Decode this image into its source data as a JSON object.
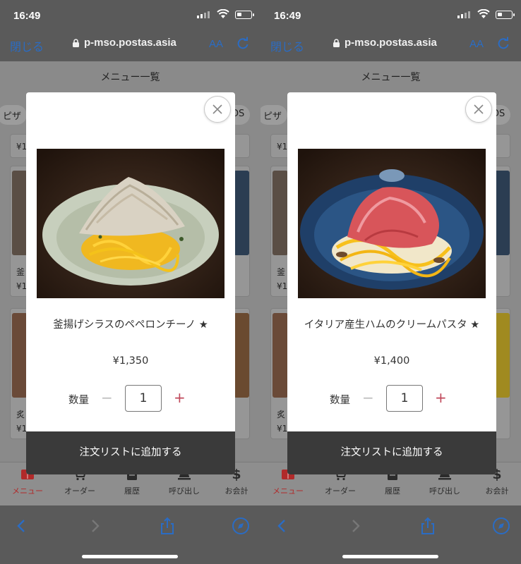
{
  "screens": [
    {
      "status": {
        "time": "16:49"
      },
      "browser": {
        "close_label": "閉じる",
        "url": "p-mso.postas.asia",
        "text_size": "AA"
      },
      "page": {
        "title": "メニュー一覧",
        "chip_left": "ピザ",
        "chip_right": "DS",
        "snippets": [
          "¥1",
          "釜",
          "¥1",
          "炙",
          "¥1"
        ]
      },
      "modal": {
        "item_name": "釜揚げシラスのペペロンチーノ ★",
        "price": "¥1,350",
        "qty_label": "数量",
        "minus": "−",
        "qty_value": "1",
        "plus": "+",
        "add_label": "注文リストに追加する",
        "photo_desc_icon": "pasta-shirasu-photo"
      },
      "tabs": [
        {
          "label": "メニュー",
          "icon": "menu-book-icon",
          "active": true
        },
        {
          "label": "オーダー",
          "icon": "cart-icon",
          "active": false
        },
        {
          "label": "履歴",
          "icon": "history-icon",
          "active": false
        },
        {
          "label": "呼び出し",
          "icon": "bell-icon",
          "active": false
        },
        {
          "label": "お会計",
          "icon": "dollar-icon",
          "active": false
        }
      ]
    },
    {
      "status": {
        "time": "16:49"
      },
      "browser": {
        "close_label": "閉じる",
        "url": "p-mso.postas.asia",
        "text_size": "AA"
      },
      "page": {
        "title": "メニュー一覧",
        "chip_left": "ピザ",
        "chip_right": "DS",
        "snippets": [
          "¥1",
          "釜",
          "¥1",
          "炙",
          "¥1"
        ]
      },
      "modal": {
        "item_name": "イタリア産生ハムのクリームパスタ ★",
        "price": "¥1,400",
        "qty_label": "数量",
        "minus": "−",
        "qty_value": "1",
        "plus": "+",
        "add_label": "注文リストに追加する",
        "photo_desc_icon": "pasta-prosciutto-photo"
      },
      "tabs": [
        {
          "label": "メニュー",
          "icon": "menu-book-icon",
          "active": true
        },
        {
          "label": "オーダー",
          "icon": "cart-icon",
          "active": false
        },
        {
          "label": "履歴",
          "icon": "history-icon",
          "active": false
        },
        {
          "label": "呼び出し",
          "icon": "bell-icon",
          "active": false
        },
        {
          "label": "お会計",
          "icon": "dollar-icon",
          "active": false
        }
      ]
    }
  ],
  "colors": {
    "accent_blue": "#2a6cc4",
    "active_tab": "#b12a2a",
    "add_button": "#3a3a3a",
    "plus": "#c0485a"
  }
}
